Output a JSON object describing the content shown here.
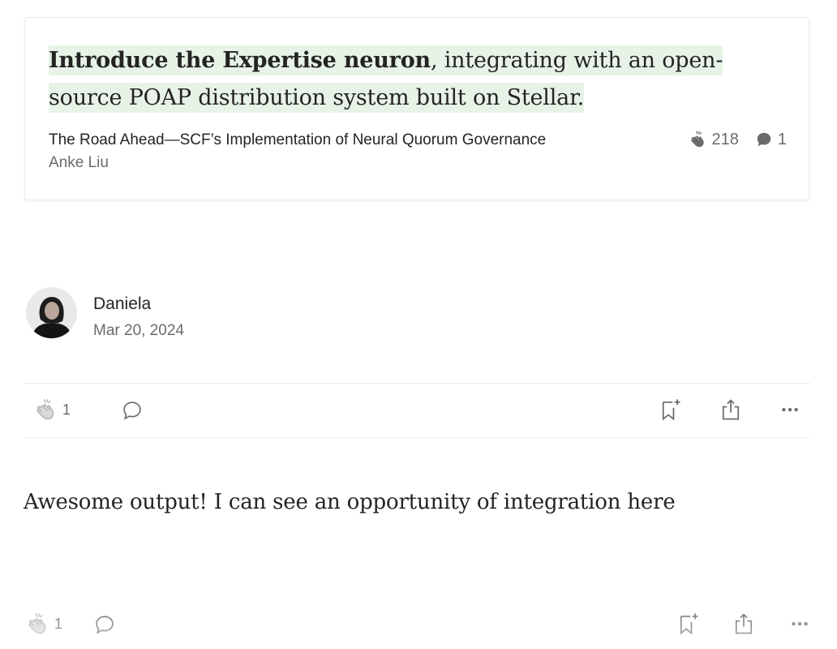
{
  "highlight": {
    "bold_text": "Introduce the Expertise neuron",
    "rest_text": ", integrating with an open-source POAP distribution system built on Stellar."
  },
  "source_story": {
    "title": "The Road Ahead—SCF’s Implementation of Neural Quorum Governance",
    "author": "Anke Liu",
    "claps": "218",
    "responses": "1"
  },
  "response": {
    "author_name": "Daniela",
    "date": "Mar 20, 2024",
    "text": "Awesome output! I can see an opportunity of integration here"
  },
  "top_actions": {
    "claps": "1"
  },
  "bottom_actions": {
    "claps": "1"
  },
  "icons": {
    "clap": "clap-icon",
    "comment": "comment-icon",
    "bookmark": "bookmark-add-icon",
    "share": "share-icon",
    "more": "more-icon"
  },
  "colors": {
    "highlight_bg": "#e8f3e8",
    "text": "#242424",
    "muted": "#6b6b6b",
    "divider": "#ececec"
  }
}
